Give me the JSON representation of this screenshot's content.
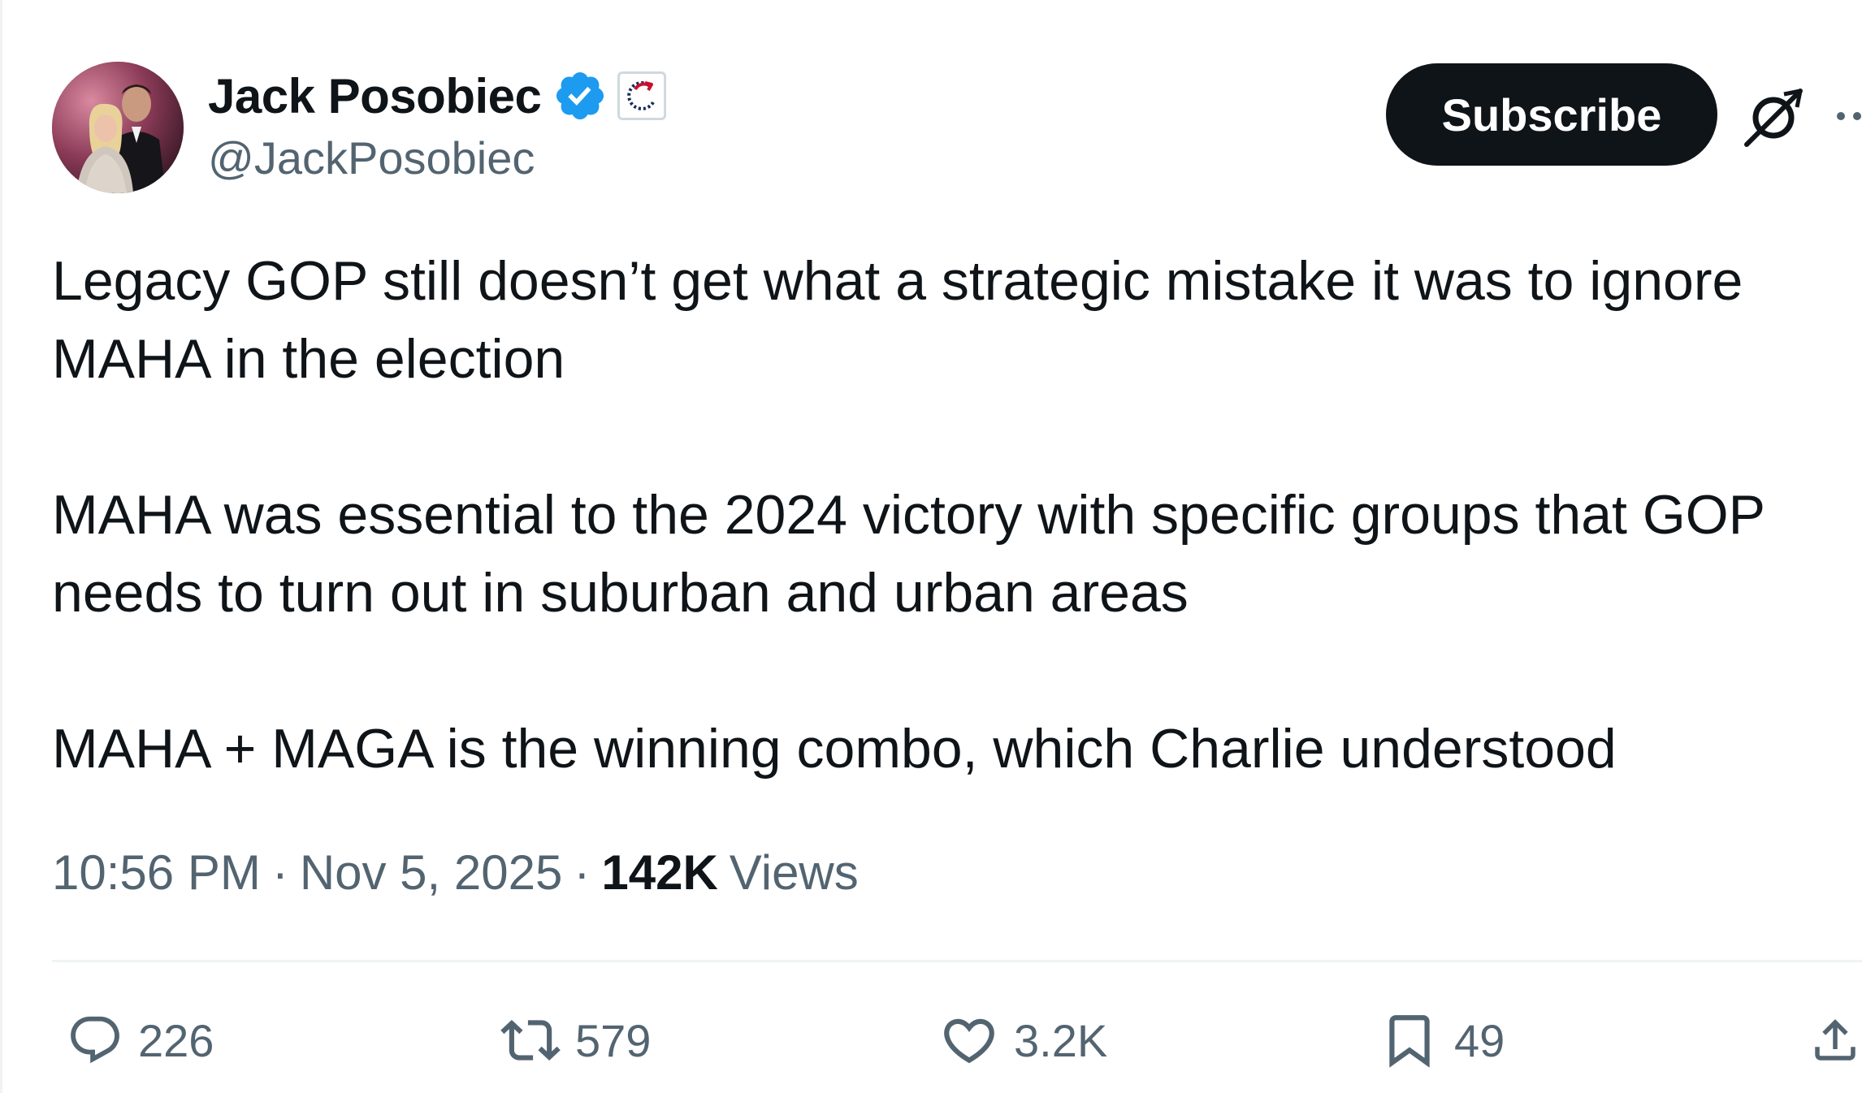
{
  "author": {
    "display_name": "Jack Posobiec",
    "handle": "@JackPosobiec",
    "verified_color": "#1d9bf0"
  },
  "header": {
    "subscribe_label": "Subscribe",
    "icons": [
      "verified-badge-icon",
      "affiliate-badge-icon",
      "grok-icon",
      "more-icon"
    ]
  },
  "tweet": {
    "paragraphs": [
      "Legacy GOP still doesn’t get what a strategic mistake it was to ignore MAHA in the election",
      "MAHA was essential to the 2024 victory with specific groups that GOP needs to turn out in suburban and urban areas",
      "MAHA + MAGA is the winning combo, which Charlie understood"
    ]
  },
  "meta": {
    "time": "10:56 PM",
    "date": "Nov 5, 2025",
    "separator": "·",
    "views_count": "142K",
    "views_label": "Views"
  },
  "actions": {
    "replies": "226",
    "reposts": "579",
    "likes": "3.2K",
    "bookmarks": "49"
  },
  "colors": {
    "text_primary": "#0f1419",
    "text_secondary": "#536471",
    "divider": "#eff3f4",
    "button_bg": "#0f1419",
    "verified": "#1d9bf0"
  }
}
